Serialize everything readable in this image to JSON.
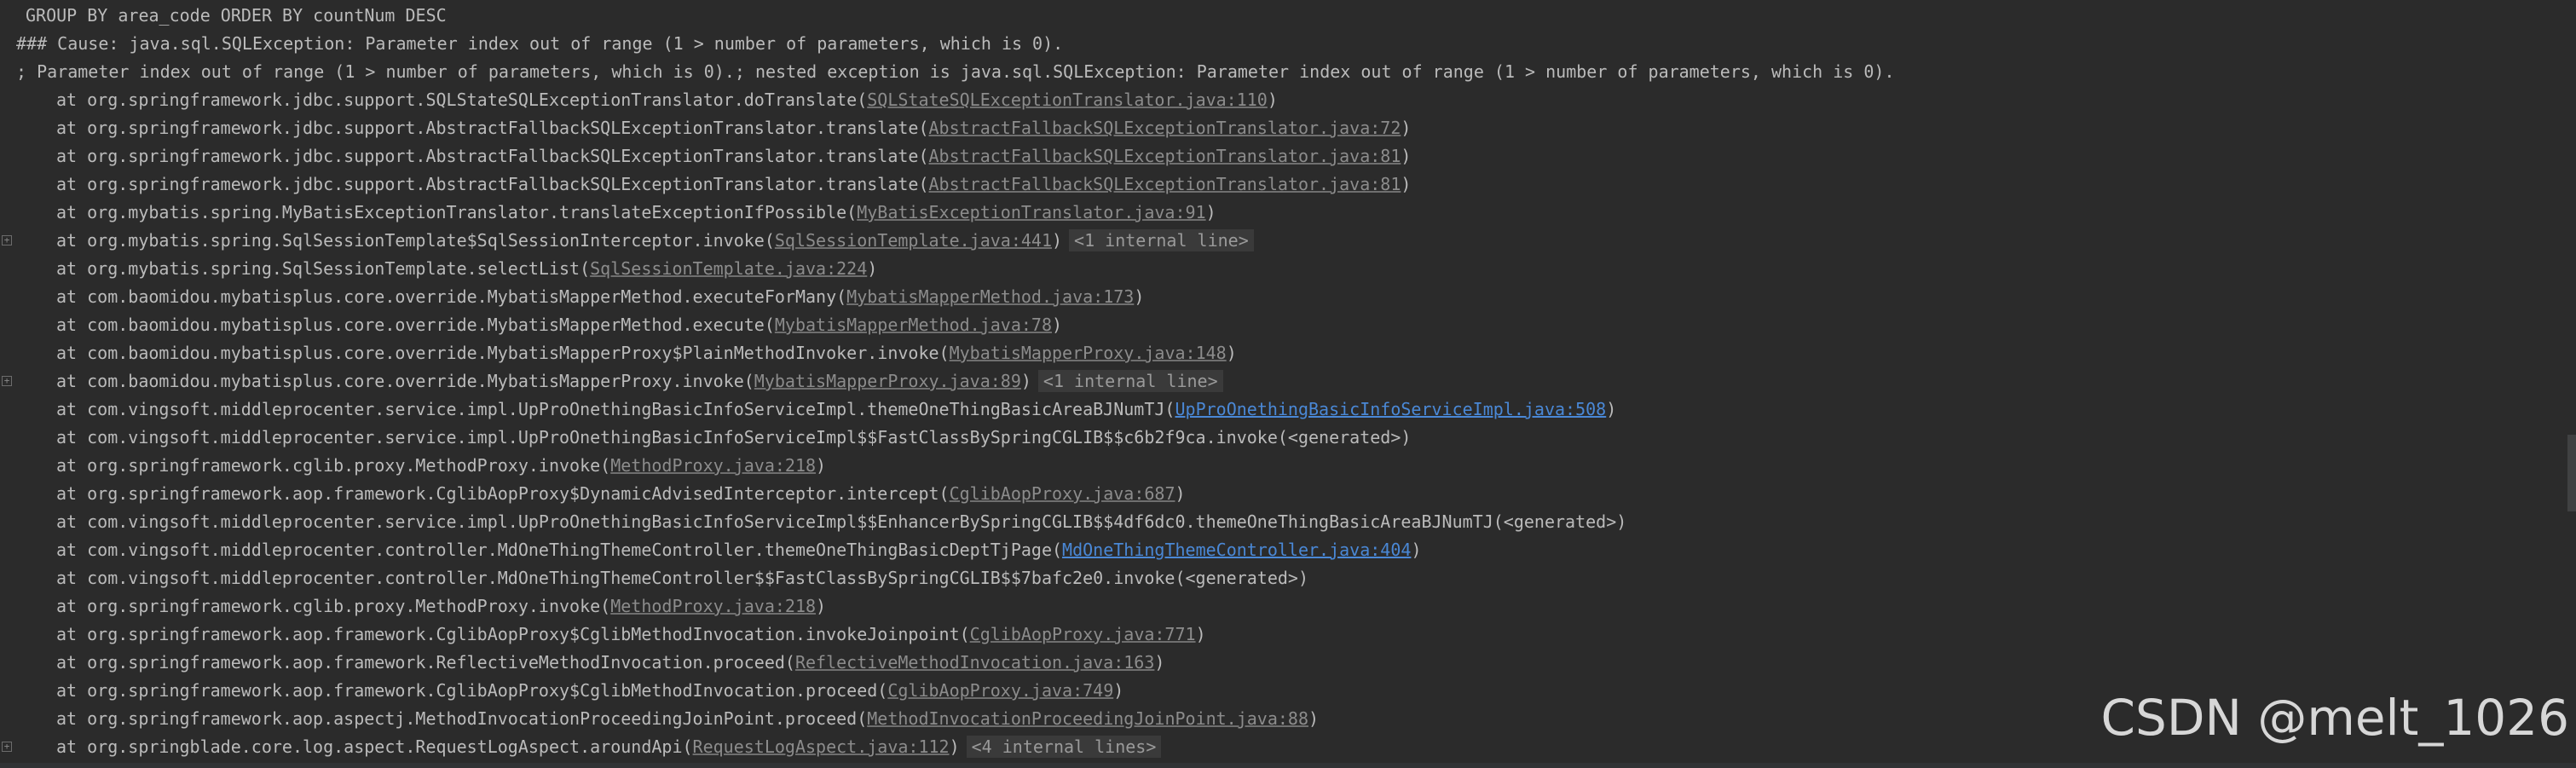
{
  "console": {
    "lines": [
      {
        "indent": 0,
        "text": "GROUP BY area_code ORDER BY countNum DESC"
      },
      {
        "indent": 1,
        "text": "### Cause: java.sql.SQLException: Parameter index out of range (1 > number of parameters, which is 0)."
      },
      {
        "indent": 1,
        "text": "; Parameter index out of range (1 > number of parameters, which is 0).; nested exception is java.sql.SQLException: Parameter index out of range (1 > number of parameters, which is 0)."
      },
      {
        "indent": 2,
        "prefix": "at org.springframework.jdbc.support.SQLStateSQLExceptionTranslator.doTranslate(",
        "link": "SQLStateSQLExceptionTranslator.java:110",
        "linkStyle": "grey",
        "suffix": ")"
      },
      {
        "indent": 2,
        "prefix": "at org.springframework.jdbc.support.AbstractFallbackSQLExceptionTranslator.translate(",
        "link": "AbstractFallbackSQLExceptionTranslator.java:72",
        "linkStyle": "grey",
        "suffix": ")"
      },
      {
        "indent": 2,
        "prefix": "at org.springframework.jdbc.support.AbstractFallbackSQLExceptionTranslator.translate(",
        "link": "AbstractFallbackSQLExceptionTranslator.java:81",
        "linkStyle": "grey",
        "suffix": ")"
      },
      {
        "indent": 2,
        "prefix": "at org.springframework.jdbc.support.AbstractFallbackSQLExceptionTranslator.translate(",
        "link": "AbstractFallbackSQLExceptionTranslator.java:81",
        "linkStyle": "grey",
        "suffix": ")"
      },
      {
        "indent": 2,
        "prefix": "at org.mybatis.spring.MyBatisExceptionTranslator.translateExceptionIfPossible(",
        "link": "MyBatisExceptionTranslator.java:91",
        "linkStyle": "grey",
        "suffix": ")"
      },
      {
        "indent": 2,
        "fold": true,
        "prefix": "at org.mybatis.spring.SqlSessionTemplate$SqlSessionInterceptor.invoke(",
        "link": "SqlSessionTemplate.java:441",
        "linkStyle": "grey",
        "suffix": ")",
        "internal": "<1 internal line>"
      },
      {
        "indent": 2,
        "prefix": "at org.mybatis.spring.SqlSessionTemplate.selectList(",
        "link": "SqlSessionTemplate.java:224",
        "linkStyle": "grey",
        "suffix": ")"
      },
      {
        "indent": 2,
        "prefix": "at com.baomidou.mybatisplus.core.override.MybatisMapperMethod.executeForMany(",
        "link": "MybatisMapperMethod.java:173",
        "linkStyle": "grey",
        "suffix": ")"
      },
      {
        "indent": 2,
        "prefix": "at com.baomidou.mybatisplus.core.override.MybatisMapperMethod.execute(",
        "link": "MybatisMapperMethod.java:78",
        "linkStyle": "grey",
        "suffix": ")"
      },
      {
        "indent": 2,
        "prefix": "at com.baomidou.mybatisplus.core.override.MybatisMapperProxy$PlainMethodInvoker.invoke(",
        "link": "MybatisMapperProxy.java:148",
        "linkStyle": "grey",
        "suffix": ")"
      },
      {
        "indent": 2,
        "fold": true,
        "prefix": "at com.baomidou.mybatisplus.core.override.MybatisMapperProxy.invoke(",
        "link": "MybatisMapperProxy.java:89",
        "linkStyle": "grey",
        "suffix": ")",
        "internal": "<1 internal line>"
      },
      {
        "indent": 2,
        "prefix": "at com.vingsoft.middleprocenter.service.impl.UpProOnethingBasicInfoServiceImpl.themeOneThingBasicAreaBJNumTJ(",
        "link": "UpProOnethingBasicInfoServiceImpl.java:508",
        "linkStyle": "blue",
        "suffix": ")"
      },
      {
        "indent": 2,
        "text": "at com.vingsoft.middleprocenter.service.impl.UpProOnethingBasicInfoServiceImpl$$FastClassBySpringCGLIB$$c6b2f9ca.invoke(<generated>)"
      },
      {
        "indent": 2,
        "prefix": "at org.springframework.cglib.proxy.MethodProxy.invoke(",
        "link": "MethodProxy.java:218",
        "linkStyle": "grey",
        "suffix": ")"
      },
      {
        "indent": 2,
        "prefix": "at org.springframework.aop.framework.CglibAopProxy$DynamicAdvisedInterceptor.intercept(",
        "link": "CglibAopProxy.java:687",
        "linkStyle": "grey",
        "suffix": ")"
      },
      {
        "indent": 2,
        "text": "at com.vingsoft.middleprocenter.service.impl.UpProOnethingBasicInfoServiceImpl$$EnhancerBySpringCGLIB$$4df6dc0.themeOneThingBasicAreaBJNumTJ(<generated>)"
      },
      {
        "indent": 2,
        "prefix": "at com.vingsoft.middleprocenter.controller.MdOneThingThemeController.themeOneThingBasicDeptTjPage(",
        "link": "MdOneThingThemeController.java:404",
        "linkStyle": "blue",
        "suffix": ")"
      },
      {
        "indent": 2,
        "text": "at com.vingsoft.middleprocenter.controller.MdOneThingThemeController$$FastClassBySpringCGLIB$$7bafc2e0.invoke(<generated>)"
      },
      {
        "indent": 2,
        "prefix": "at org.springframework.cglib.proxy.MethodProxy.invoke(",
        "link": "MethodProxy.java:218",
        "linkStyle": "grey",
        "suffix": ")"
      },
      {
        "indent": 2,
        "prefix": "at org.springframework.aop.framework.CglibAopProxy$CglibMethodInvocation.invokeJoinpoint(",
        "link": "CglibAopProxy.java:771",
        "linkStyle": "grey",
        "suffix": ")"
      },
      {
        "indent": 2,
        "prefix": "at org.springframework.aop.framework.ReflectiveMethodInvocation.proceed(",
        "link": "ReflectiveMethodInvocation.java:163",
        "linkStyle": "grey",
        "suffix": ")"
      },
      {
        "indent": 2,
        "prefix": "at org.springframework.aop.framework.CglibAopProxy$CglibMethodInvocation.proceed(",
        "link": "CglibAopProxy.java:749",
        "linkStyle": "grey",
        "suffix": ")"
      },
      {
        "indent": 2,
        "prefix": "at org.springframework.aop.aspectj.MethodInvocationProceedingJoinPoint.proceed(",
        "link": "MethodInvocationProceedingJoinPoint.java:88",
        "linkStyle": "grey",
        "suffix": ")"
      },
      {
        "indent": 2,
        "fold": true,
        "prefix": "at org.springblade.core.log.aspect.RequestLogAspect.aroundApi(",
        "link": "RequestLogAspect.java:112",
        "linkStyle": "grey",
        "suffix": ")",
        "internal": "<4 internal lines>"
      }
    ]
  },
  "watermark": "CSDN @melt_1026",
  "colors": {
    "background": "#2b2b2b",
    "text": "#bbbbbb",
    "link_grey": "#8c8c8c",
    "link_blue": "#4a88d6"
  }
}
